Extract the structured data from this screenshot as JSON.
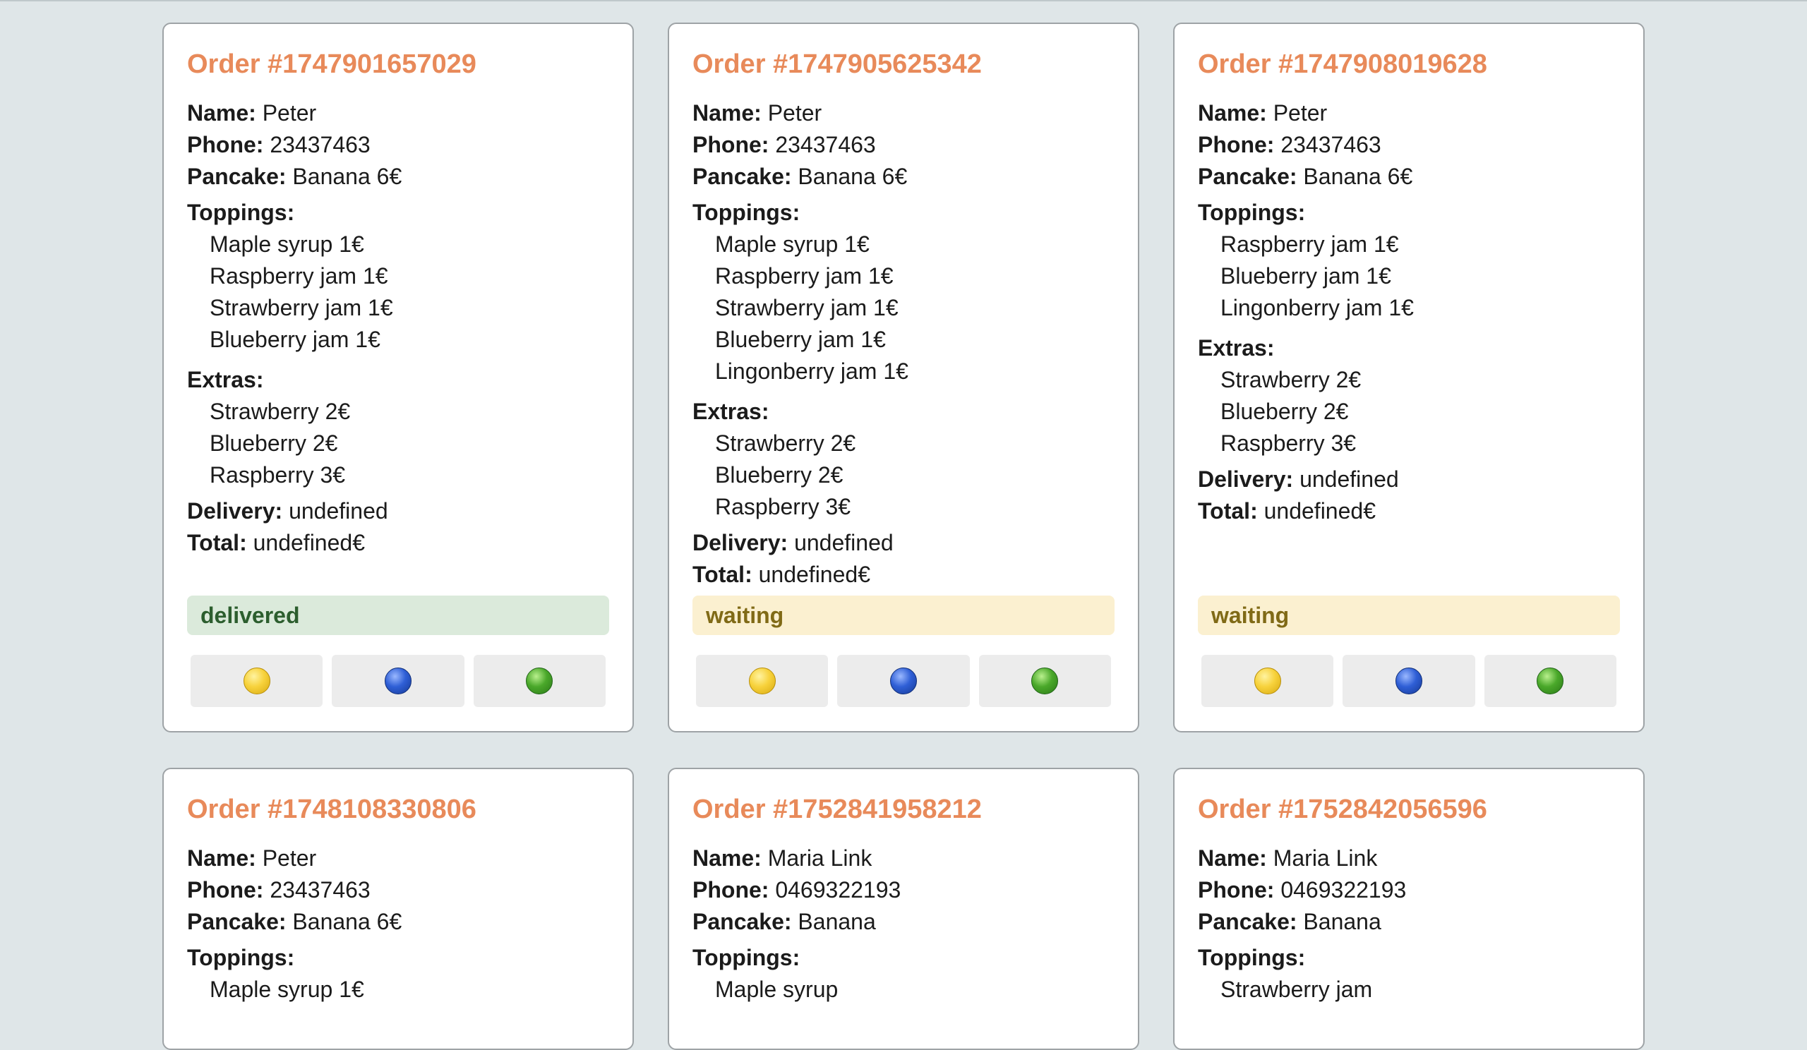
{
  "labels": {
    "name": "Name:",
    "phone": "Phone:",
    "pancake": "Pancake:",
    "toppings": "Toppings:",
    "extras": "Extras:",
    "delivery": "Delivery:",
    "total": "Total:"
  },
  "status_colors": {
    "delivered_bg": "#dbeadb",
    "delivered_text": "#2c5e2e",
    "waiting_bg": "#fbf0d0",
    "waiting_text": "#806a16"
  },
  "accent_color": "#e88a5a",
  "action_icons": [
    "yellow-circle-icon",
    "blue-circle-icon",
    "green-circle-icon"
  ],
  "orders": [
    {
      "title": "Order #1747901657029",
      "name": "Peter",
      "phone": "23437463",
      "pancake": "Banana 6€",
      "toppings": [
        "Maple syrup 1€",
        "Raspberry jam 1€",
        "Strawberry jam 1€",
        "Blueberry jam 1€"
      ],
      "extras": [
        "Strawberry 2€",
        "Blueberry 2€",
        "Raspberry 3€"
      ],
      "delivery": "undefined",
      "total": "undefined€",
      "status": "delivered"
    },
    {
      "title": "Order #1747905625342",
      "name": "Peter",
      "phone": "23437463",
      "pancake": "Banana 6€",
      "toppings": [
        "Maple syrup 1€",
        "Raspberry jam 1€",
        "Strawberry jam 1€",
        "Blueberry jam 1€",
        "Lingonberry jam 1€"
      ],
      "extras": [
        "Strawberry 2€",
        "Blueberry 2€",
        "Raspberry 3€"
      ],
      "delivery": "undefined",
      "total": "undefined€",
      "status": "waiting"
    },
    {
      "title": "Order #1747908019628",
      "name": "Peter",
      "phone": "23437463",
      "pancake": "Banana 6€",
      "toppings": [
        "Raspberry jam 1€",
        "Blueberry jam 1€",
        "Lingonberry jam 1€"
      ],
      "extras": [
        "Strawberry 2€",
        "Blueberry 2€",
        "Raspberry 3€"
      ],
      "delivery": "undefined",
      "total": "undefined€",
      "status": "waiting"
    },
    {
      "title": "Order #1748108330806",
      "name": "Peter",
      "phone": "23437463",
      "pancake": "Banana 6€",
      "toppings": [
        "Maple syrup 1€"
      ]
    },
    {
      "title": "Order #1752841958212",
      "name": "Maria Link",
      "phone": "0469322193",
      "pancake": "Banana",
      "toppings": [
        "Maple syrup"
      ]
    },
    {
      "title": "Order #1752842056596",
      "name": "Maria Link",
      "phone": "0469322193",
      "pancake": "Banana",
      "toppings": [
        "Strawberry jam"
      ]
    }
  ]
}
